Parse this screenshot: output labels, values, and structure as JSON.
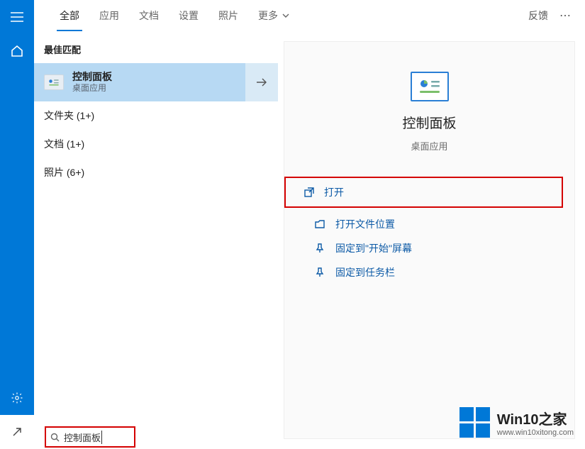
{
  "tabs": {
    "items": [
      {
        "label": "全部",
        "active": true
      },
      {
        "label": "应用"
      },
      {
        "label": "文档"
      },
      {
        "label": "设置"
      },
      {
        "label": "照片"
      },
      {
        "label": "更多",
        "hasChevron": true
      }
    ],
    "feedback": "反馈"
  },
  "left": {
    "section_title": "最佳匹配",
    "result": {
      "name": "控制面板",
      "subtitle": "桌面应用"
    },
    "categories": [
      {
        "label": "文件夹 (1+)"
      },
      {
        "label": "文档 (1+)"
      },
      {
        "label": "照片 (6+)"
      }
    ]
  },
  "panel": {
    "title": "控制面板",
    "subtitle": "桌面应用",
    "actions": {
      "open": "打开",
      "open_location": "打开文件位置",
      "pin_start": "固定到\"开始\"屏幕",
      "pin_taskbar": "固定到任务栏"
    }
  },
  "search": {
    "value": "控制面板"
  },
  "watermark": {
    "title": "Win10之家",
    "url": "www.win10xitong.com"
  }
}
